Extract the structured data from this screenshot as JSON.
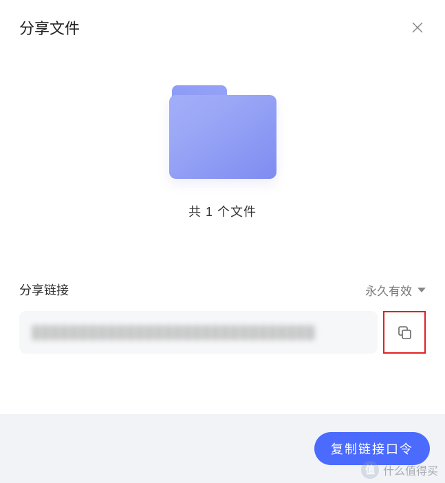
{
  "header": {
    "title": "分享文件"
  },
  "folder": {
    "count_text": "共 1 个文件"
  },
  "link": {
    "label": "分享链接",
    "validity": "永久有效",
    "value_masked": "██████████████████████████████"
  },
  "footer": {
    "copy_button": "复制链接口令"
  },
  "watermark": {
    "badge": "值",
    "text": "什么值得买"
  }
}
